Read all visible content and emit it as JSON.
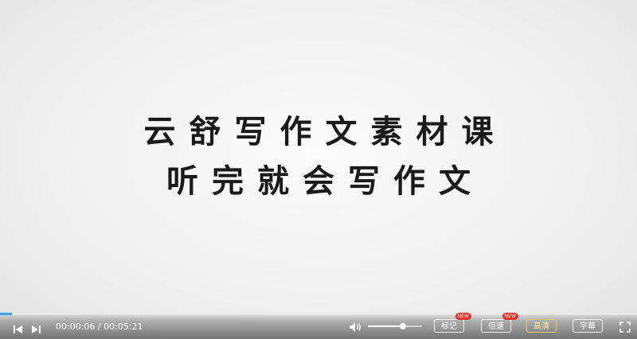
{
  "video": {
    "title_line_1": "云舒写作文素材课",
    "title_line_2": "听完就会写作文"
  },
  "controls": {
    "time_display": "00:00:06 / 00:05:21",
    "progress_fraction": 0.019,
    "volume_fraction": 0.65,
    "buttons": {
      "mark_label": "标记",
      "mark_badge": "NEW",
      "speed_label": "倍速",
      "speed_badge": "NEW",
      "quality_label": "高清",
      "subtitle_label": "字幕"
    },
    "icons": {
      "prev": "skip-previous-icon",
      "play": "play-icon",
      "volume": "volume-icon",
      "fullscreen": "fullscreen-icon"
    },
    "colors": {
      "progress": "#3fa2f0",
      "badge": "#e5332a",
      "quality_accent": "#e8c770"
    }
  }
}
